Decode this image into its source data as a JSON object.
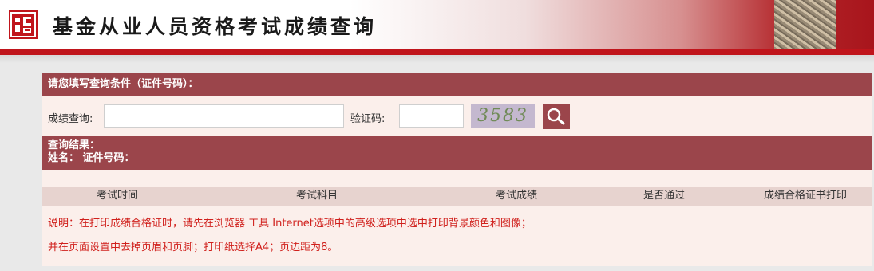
{
  "header": {
    "title": "基金从业人员资格考试成绩查询",
    "logo_icon": "seal-logo-icon",
    "brand_color": "#c0151c"
  },
  "query": {
    "section_title": "请您填写查询条件（证件号码）：",
    "score_label": "成绩查询:",
    "score_value": "",
    "captcha_label": "验证码:",
    "captcha_value": "",
    "captcha_image_text": "3583",
    "search_icon": "search-icon"
  },
  "result": {
    "title": "查询结果：",
    "name_line": "姓名：  证件号码："
  },
  "table": {
    "columns": [
      "考试时间",
      "考试科目",
      "考试成绩",
      "是否通过",
      "成绩合格证书打印"
    ]
  },
  "notes": [
    "说明：在打印成绩合格证时，请先在浏览器 工具 Internet选项中的高级选项中选中打印背景颜色和图像；",
    "并在页面设置中去掉页眉和页脚；打印纸选择A4；页边距为8。"
  ],
  "colors": {
    "panel_header": "#9b454b",
    "panel_bg": "#fbefeb",
    "table_head_bg": "#e7d3cf",
    "note_text": "#d0201c"
  }
}
